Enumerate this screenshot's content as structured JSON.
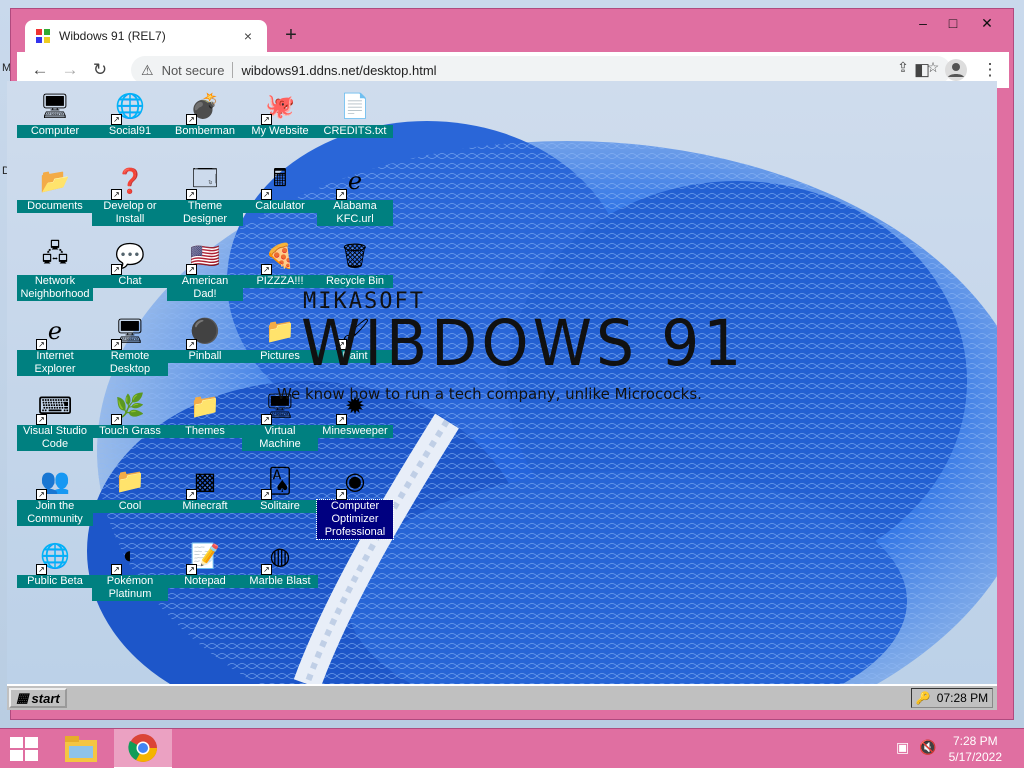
{
  "browser": {
    "tab_title": "Wibdows 91 (REL7)",
    "tab_close": "×",
    "new_tab": "+",
    "controls": {
      "minimize": "–",
      "maximize": "□",
      "close": "✕"
    },
    "toolbar": {
      "back": "←",
      "forward": "→",
      "reload": "↻"
    },
    "security_label": "Not secure",
    "url": "wibdows91.ddns.net/desktop.html"
  },
  "host_edge_letters": [
    "M",
    "D"
  ],
  "desktop": {
    "brand_small": "MIKASOFT",
    "brand_big": "WIBDOWS 91",
    "tagline": "We know how to run a tech company, unlike Micrococks.",
    "icons": [
      {
        "label": "Computer",
        "icon": "computer-icon"
      },
      {
        "label": "Social91",
        "icon": "globe-icon",
        "shortcut": true
      },
      {
        "label": "Bomberman",
        "icon": "bomberman-icon",
        "shortcut": true
      },
      {
        "label": "My Website",
        "icon": "github-icon",
        "shortcut": true
      },
      {
        "label": "CREDITS.txt",
        "icon": "text-file-icon"
      },
      {
        "label": "Documents",
        "icon": "folder-open-icon"
      },
      {
        "label": "Develop or Install",
        "icon": "help-icon",
        "shortcut": true
      },
      {
        "label": "Theme Designer",
        "icon": "window-icon",
        "shortcut": true
      },
      {
        "label": "Calculator",
        "icon": "calculator-icon",
        "shortcut": true
      },
      {
        "label": "Alabama KFC.url",
        "icon": "ie-icon",
        "shortcut": true
      },
      {
        "label": "Network Neighborhood",
        "icon": "network-icon"
      },
      {
        "label": "Chat",
        "icon": "chat-bubble-icon",
        "shortcut": true
      },
      {
        "label": "American Dad!",
        "icon": "us-flag-icon",
        "shortcut": true
      },
      {
        "label": "PIZZZA!!!",
        "icon": "pizza-icon",
        "shortcut": true
      },
      {
        "label": "Recycle Bin",
        "icon": "recycle-bin-icon"
      },
      {
        "label": "Internet Explorer",
        "icon": "ie-icon",
        "shortcut": true
      },
      {
        "label": "Remote Desktop",
        "icon": "remote-desktop-icon",
        "shortcut": true
      },
      {
        "label": "Pinball",
        "icon": "pinball-icon",
        "shortcut": true
      },
      {
        "label": "Pictures",
        "icon": "folder-icon"
      },
      {
        "label": "Paint",
        "icon": "paint-icon",
        "shortcut": true
      },
      {
        "label": "Visual Studio Code",
        "icon": "vscode-icon",
        "shortcut": true
      },
      {
        "label": "Touch Grass",
        "icon": "grass-icon",
        "shortcut": true
      },
      {
        "label": "Themes",
        "icon": "folder-icon"
      },
      {
        "label": "Virtual Machine",
        "icon": "computer-icon",
        "shortcut": true
      },
      {
        "label": "Minesweeper",
        "icon": "mine-icon",
        "shortcut": true
      },
      {
        "label": "Join the Community",
        "icon": "people-icon",
        "shortcut": true
      },
      {
        "label": "Cool",
        "icon": "folder-icon"
      },
      {
        "label": "Minecraft",
        "icon": "minecraft-icon",
        "shortcut": true
      },
      {
        "label": "Solitaire",
        "icon": "cards-icon",
        "shortcut": true
      },
      {
        "label": "Computer Optimizer Professional",
        "icon": "optimizer-icon",
        "shortcut": true,
        "selected": true
      },
      {
        "label": "Public Beta",
        "icon": "globe-icon",
        "shortcut": true
      },
      {
        "label": "Pokémon Platinum",
        "icon": "pokemon-icon",
        "shortcut": true
      },
      {
        "label": "Notepad",
        "icon": "notepad-icon",
        "shortcut": true
      },
      {
        "label": "Marble Blast",
        "icon": "marble-icon",
        "shortcut": true
      }
    ]
  },
  "w91_taskbar": {
    "start_label": "start",
    "time": "07:28 PM"
  },
  "host_taskbar": {
    "time": "7:28 PM",
    "date": "5/17/2022"
  },
  "colors": {
    "window_frame": "#e06fa1",
    "icon_label_bg": "#008080",
    "selected_label_bg": "#000080",
    "taskbar_w91": "#c0c0c0"
  }
}
